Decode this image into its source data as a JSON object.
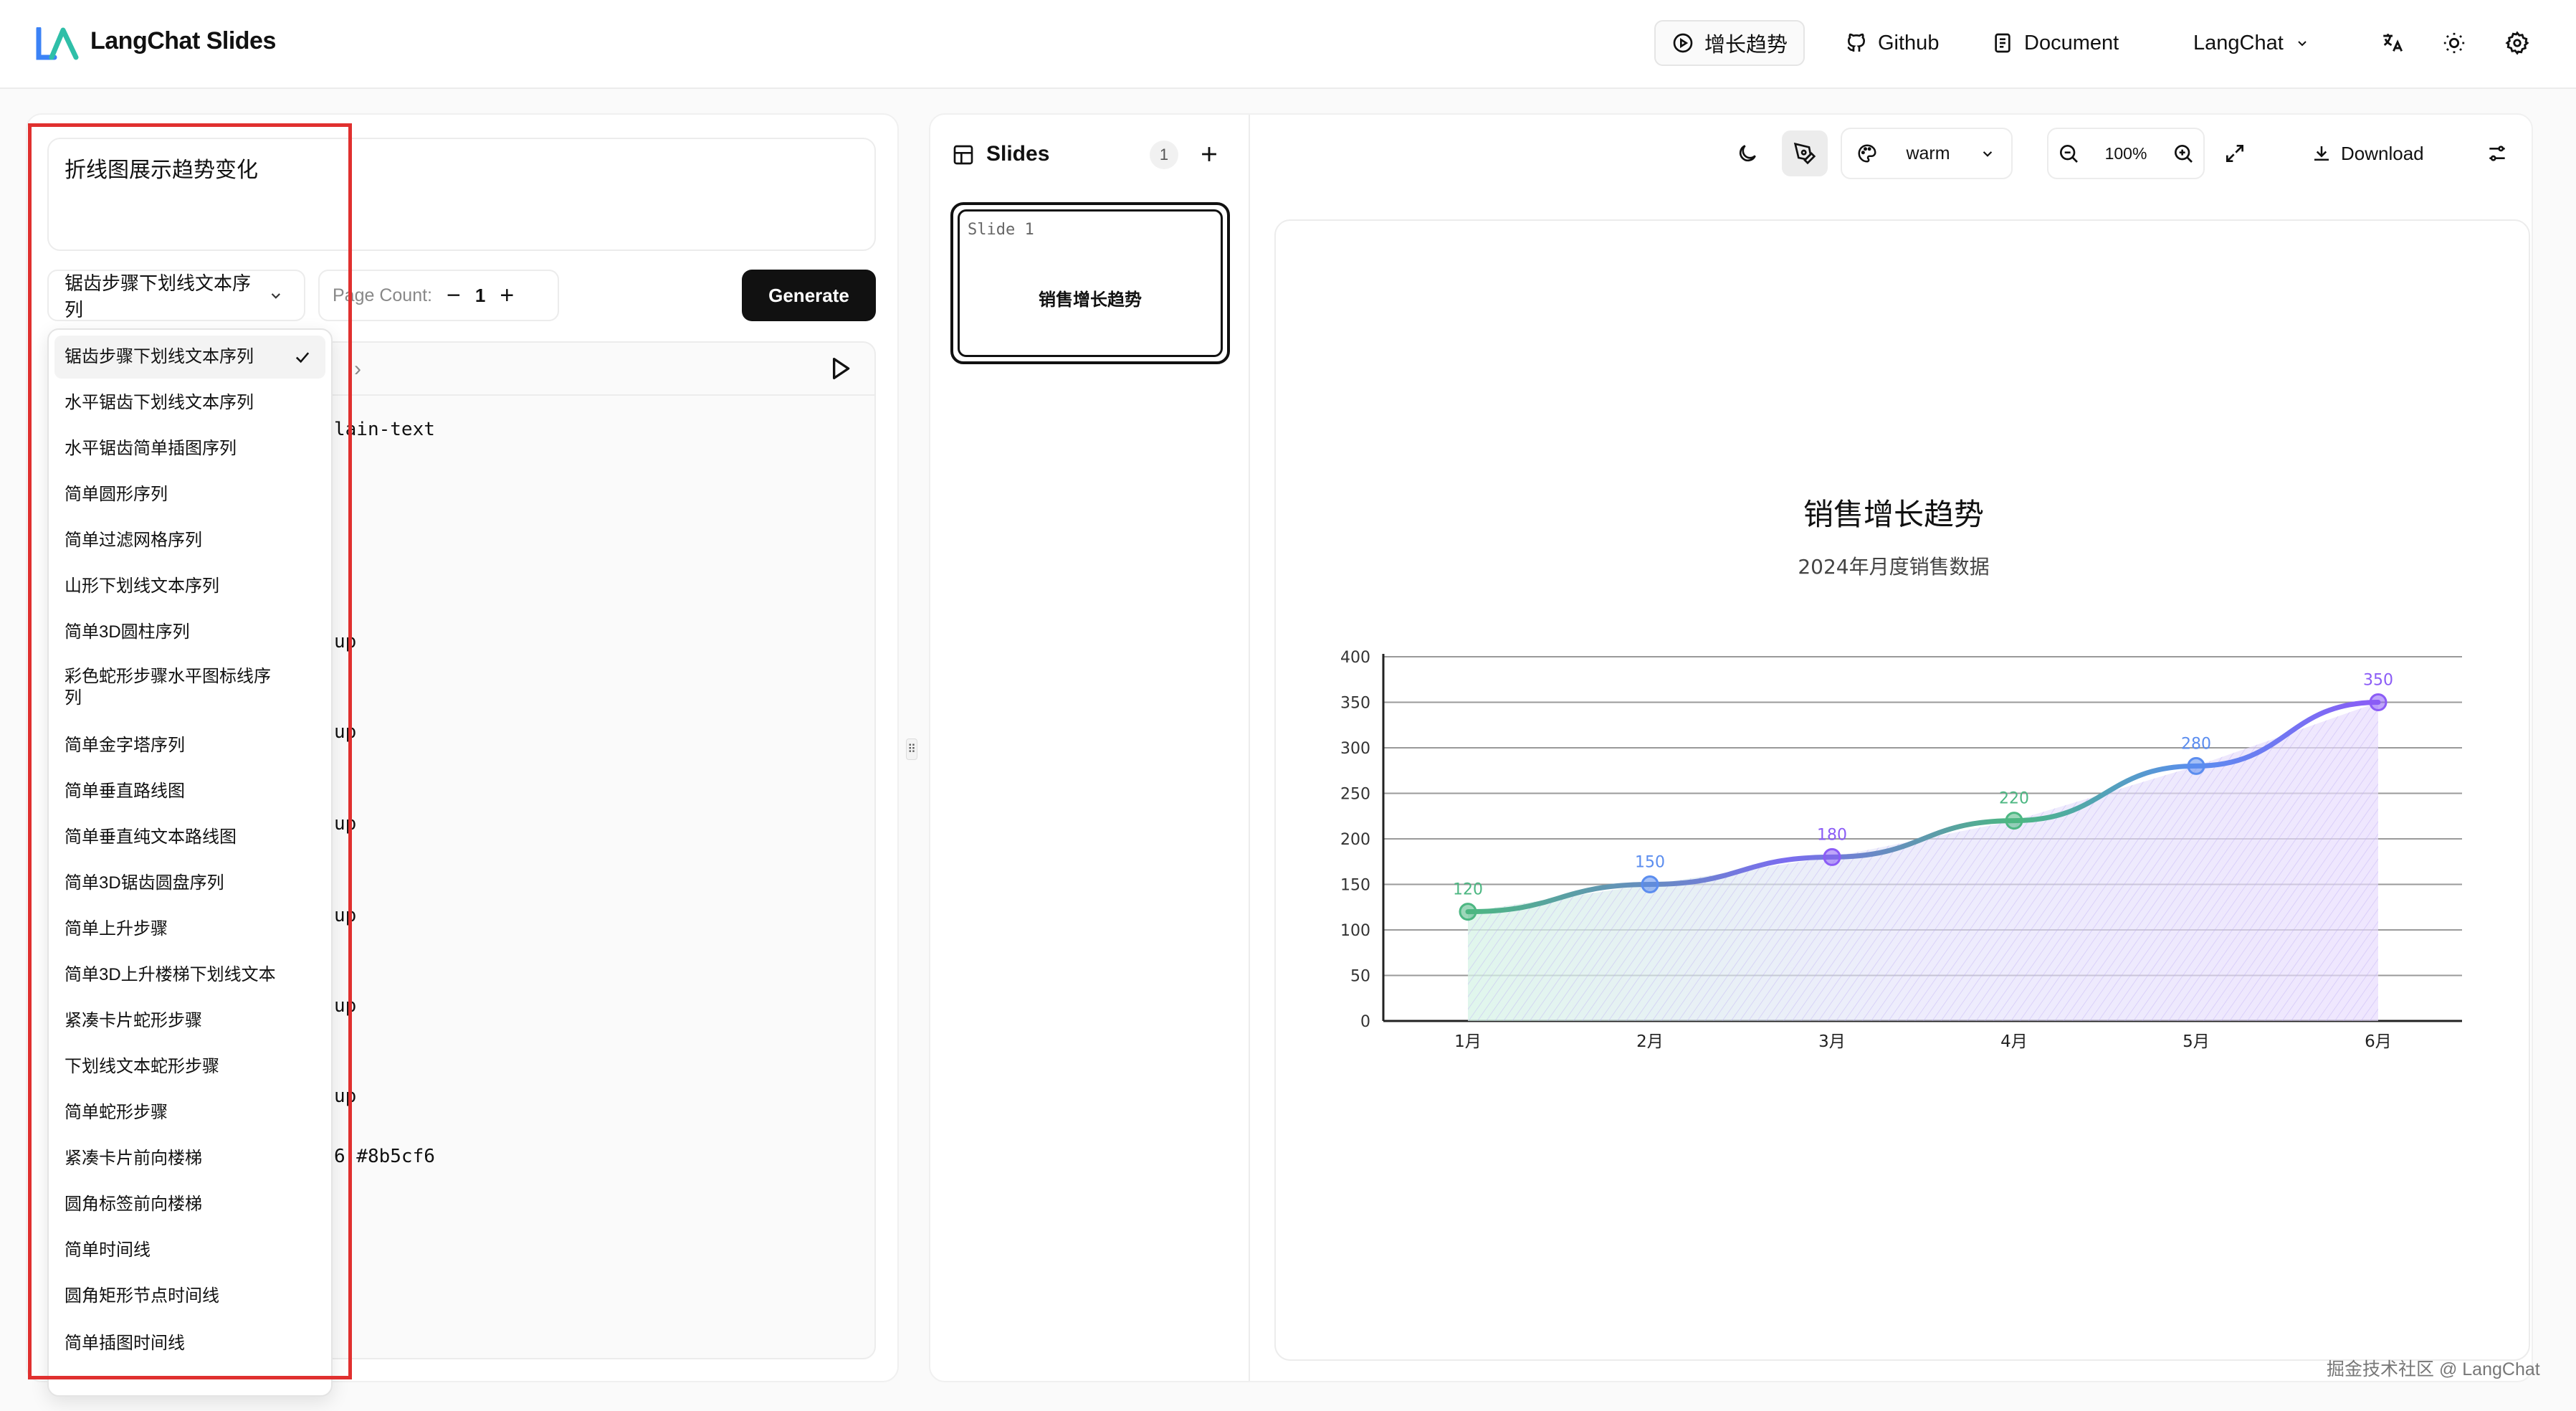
{
  "header": {
    "brand": "LangChat Slides",
    "nav": {
      "trend": "增长趋势",
      "github": "Github",
      "document": "Document",
      "account": "LangChat"
    },
    "colors": {
      "brand_blue": "#3b82f6",
      "brand_teal": "#2fbfa8"
    }
  },
  "left": {
    "prompt": "折线图展示趋势变化",
    "template_select": "锯齿步骤下划线文本序列",
    "page_count_label": "Page Count:",
    "page_count_value": "1",
    "minus": "−",
    "plus": "+",
    "generate": "Generate",
    "code_fragments": [
      "lain-text",
      "up",
      "up",
      "up",
      "up",
      "up",
      "up",
      "6 #8b5cf6"
    ],
    "dropdown": [
      "锯齿步骤下划线文本序列",
      "水平锯齿下划线文本序列",
      "水平锯齿简单插图序列",
      "简单圆形序列",
      "简单过滤网格序列",
      "山形下划线文本序列",
      "简单3D圆柱序列",
      "彩色蛇形步骤水平图标线序列",
      "简单金字塔序列",
      "简单垂直路线图",
      "简单垂直纯文本路线图",
      "简单3D锯齿圆盘序列",
      "简单上升步骤",
      "简单3D上升楼梯下划线文本",
      "紧凑卡片蛇形步骤",
      "下划线文本蛇形步骤",
      "简单蛇形步骤",
      "紧凑卡片前向楼梯",
      "圆角标签前向楼梯",
      "简单时间线",
      "圆角矩形节点时间线",
      "简单插图时间线"
    ],
    "highlight_color": "#e0302f"
  },
  "slides": {
    "title": "Slides",
    "count": "1",
    "thumb_label": "Slide 1",
    "thumb_title": "销售增长趋势",
    "theme": "warm",
    "zoom": "100%",
    "download": "Download"
  },
  "chart_data": {
    "type": "line",
    "title": "销售增长趋势",
    "subtitle": "2024年月度销售数据",
    "categories": [
      "1月",
      "2月",
      "3月",
      "4月",
      "5月",
      "6月"
    ],
    "values": [
      120,
      150,
      180,
      220,
      280,
      350
    ],
    "ylim": [
      0,
      400
    ],
    "yticks": [
      0,
      50,
      100,
      150,
      200,
      250,
      300,
      350,
      400
    ],
    "grid": true,
    "point_colors": [
      "#4cb782",
      "#5b8def",
      "#8b5cf6",
      "#4cb782",
      "#5b8def",
      "#8b5cf6"
    ]
  },
  "watermark": "掘金技术社区 @ LangChat"
}
